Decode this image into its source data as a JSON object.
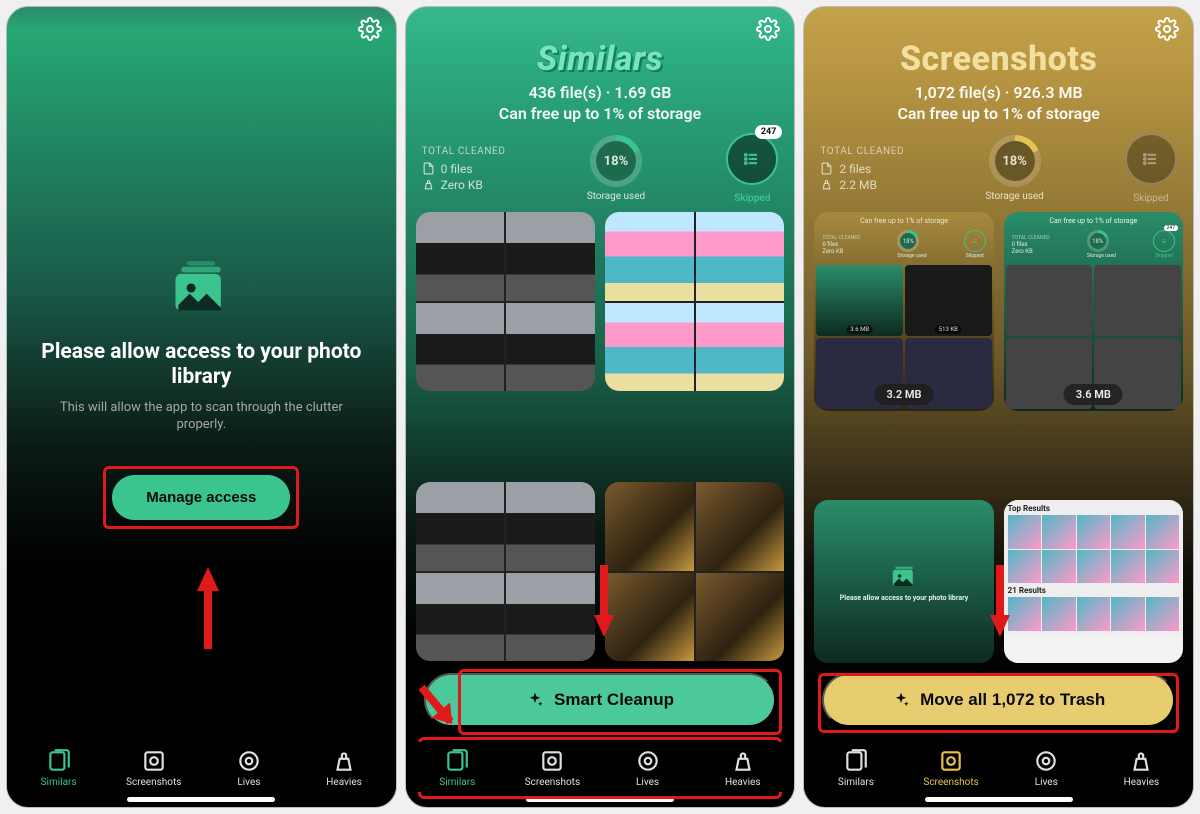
{
  "screen1": {
    "title": "Please allow access to your photo library",
    "subtitle": "This will allow the app to scan through the clutter properly.",
    "button": "Manage access"
  },
  "screen2": {
    "title": "Similars",
    "files_line": "436 file(s) · 1.69 GB",
    "free_line": "Can free up to 1% of storage",
    "total_cleaned_label": "TOTAL CLEANED",
    "files": "0 files",
    "size": "Zero KB",
    "storage_pct": "18%",
    "storage_label": "Storage used",
    "skipped_count": "247",
    "skipped_label": "Skipped",
    "button": "Smart Cleanup"
  },
  "screen3": {
    "title": "Screenshots",
    "files_line": "1,072 file(s) · 926.3 MB",
    "free_line": "Can free up to 1% of storage",
    "total_cleaned_label": "TOTAL CLEANED",
    "files": "2 files",
    "size": "2.2 MB",
    "storage_pct": "18%",
    "storage_label": "Storage used",
    "skipped_label": "Skipped",
    "card1": {
      "top": "Can free up to 1% of storage",
      "tc": "TOTAL CLEANED",
      "files": "0 files",
      "size": "Zero KB",
      "pct": "18%",
      "su": "Storage used",
      "sk": "Skipped",
      "b1": "3.6 MB",
      "b2": "513 KB",
      "badge": "3.2 MB"
    },
    "card2": {
      "top": "Can free up to 1% of storage",
      "tc": "TOTAL CLEANED",
      "files": "0 files",
      "size": "Zero KB",
      "pct": "18%",
      "su": "Storage used",
      "sk": "Skipped",
      "skc": "247",
      "badge": "3.6 MB"
    },
    "card3": {
      "perm_title": "Please allow access to your photo library"
    },
    "card4": {
      "top_results": "Top Results",
      "results_21": "21 Results"
    },
    "button": "Move all 1,072 to Trash"
  },
  "tabs": {
    "similars": "Similars",
    "screenshots": "Screenshots",
    "lives": "Lives",
    "heavies": "Heavies"
  }
}
